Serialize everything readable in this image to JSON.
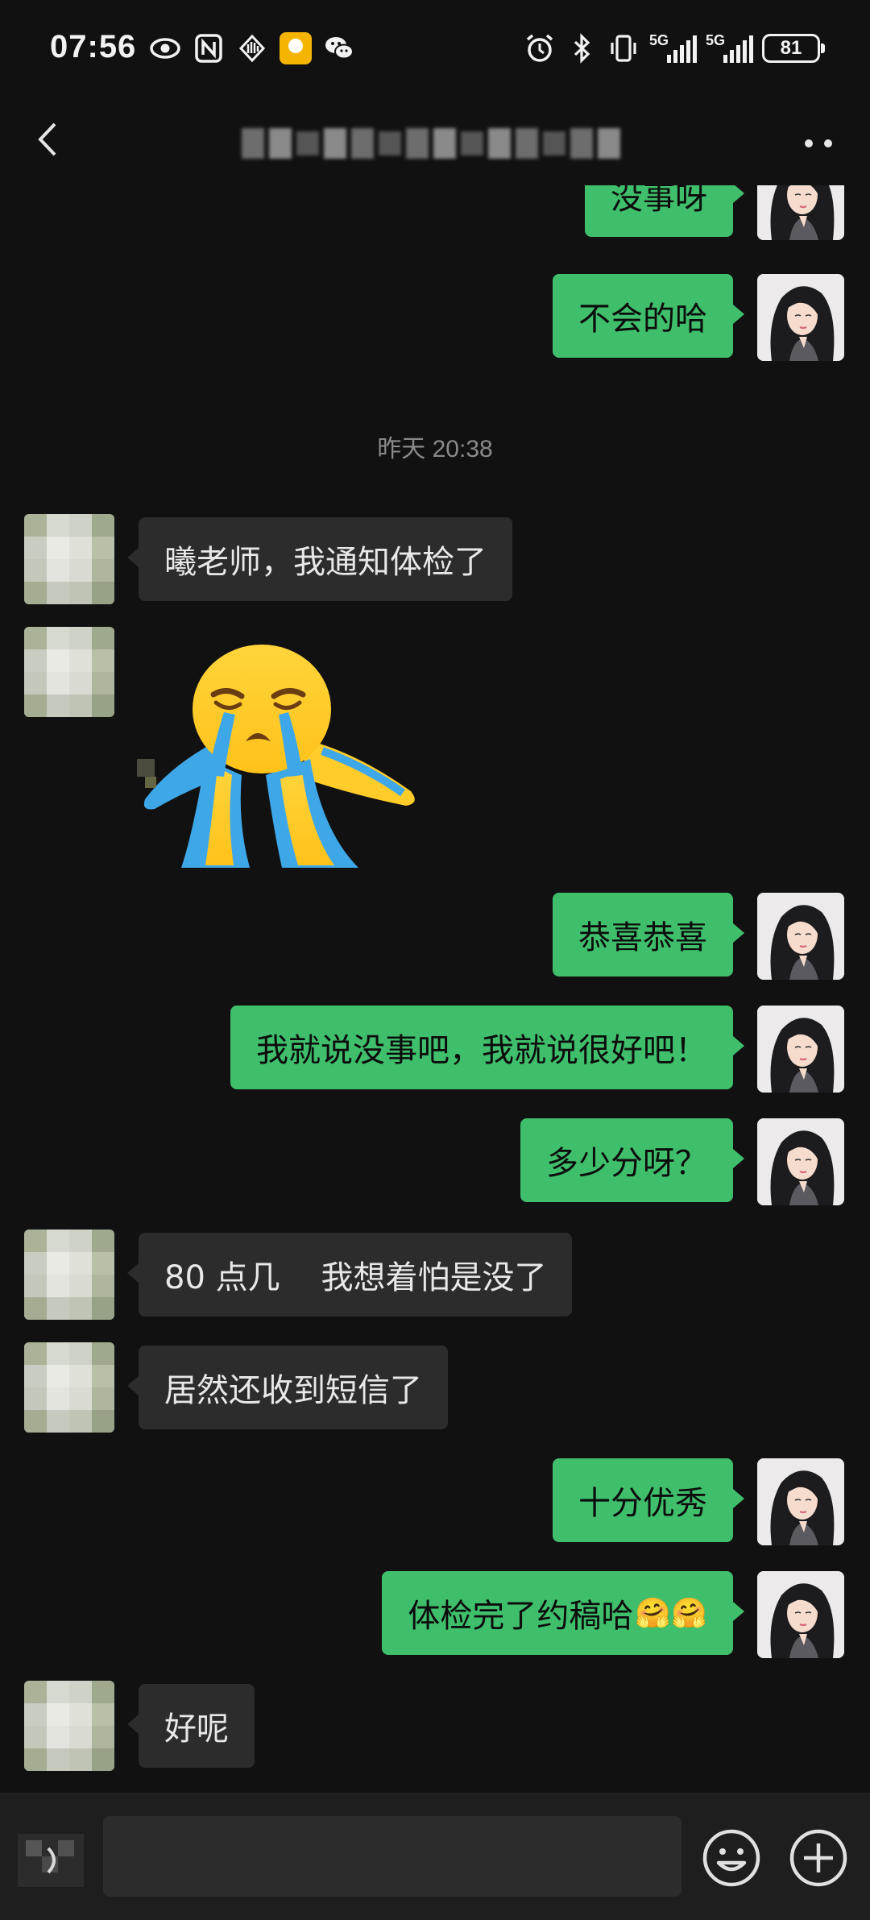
{
  "status_bar": {
    "time": "07:56",
    "left_icons": [
      "eye-icon",
      "nfc-icon",
      "hand-icon",
      "app-badge-icon",
      "wechat-icon"
    ],
    "right_icons": [
      "alarm-icon",
      "bluetooth-icon",
      "vibrate-icon",
      "signal-5g-icon",
      "signal-5g-icon"
    ],
    "network_1": "5G",
    "network_2": "5G",
    "battery": "81"
  },
  "nav": {
    "back_icon": "chevron-left-icon",
    "title": "",
    "more_icon": "more-dots-icon"
  },
  "messages": [
    {
      "from": "me",
      "text": "没事呀"
    },
    {
      "from": "me",
      "text": "不会的哈"
    },
    {
      "type": "timestamp",
      "text": "昨天 20:38"
    },
    {
      "from": "other",
      "text": "曦老师，我通知体检了"
    },
    {
      "from": "other",
      "type": "sticker",
      "sticker": "crying-emoji-sticker"
    },
    {
      "from": "me",
      "text": "恭喜恭喜"
    },
    {
      "from": "me",
      "text": "我就说没事吧，我就说很好吧！"
    },
    {
      "from": "me",
      "text": "多少分呀？"
    },
    {
      "from": "other",
      "text": "80 点几    我想着怕是没了"
    },
    {
      "from": "other",
      "text": "居然还收到短信了"
    },
    {
      "from": "me",
      "text": "十分优秀"
    },
    {
      "from": "me",
      "text": "体检完了约稿哈",
      "emoji": "🤗🤗"
    },
    {
      "from": "other",
      "text": "好呢"
    }
  ],
  "input_bar": {
    "voice_icon": "voice-icon",
    "placeholder": "",
    "emoji_icon": "emoji-smile-icon",
    "plus_icon": "plus-circle-icon"
  },
  "colors": {
    "background": "#111111",
    "bubble_me": "#3fbf6b",
    "bubble_other": "#2c2c2c",
    "timestamp": "#8a8a8a",
    "input_bar": "#1e1e1e"
  }
}
